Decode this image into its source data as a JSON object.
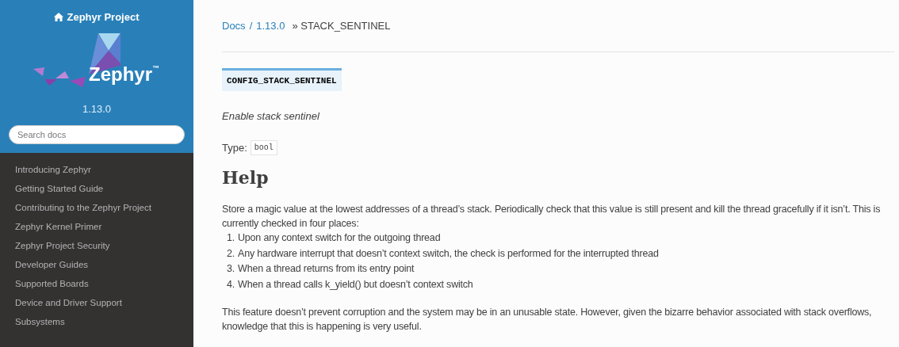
{
  "sidebar": {
    "project_link": "Zephyr Project",
    "logo": {
      "word": "Zephyr",
      "mark": "™"
    },
    "version": "1.13.0",
    "search": {
      "placeholder": "Search docs"
    },
    "items": [
      "Introducing Zephyr",
      "Getting Started Guide",
      "Contributing to the Zephyr Project",
      "Zephyr Kernel Primer",
      "Zephyr Project Security",
      "Developer Guides",
      "Supported Boards",
      "Device and Driver Support",
      "Subsystems"
    ]
  },
  "breadcrumb": {
    "links": [
      "Docs",
      "1.13.0"
    ],
    "separator": "/",
    "current": "» STACK_SENTINEL"
  },
  "option": {
    "name": "CONFIG_STACK_SENTINEL",
    "prompt": "Enable stack sentinel",
    "type_label": "Type:",
    "type": "bool"
  },
  "help": {
    "heading": "Help",
    "intro": "Store a magic value at the lowest addresses of a thread’s stack. Periodically check that this value is still present and kill the thread gracefully if it isn’t. This is currently checked in four places:",
    "list": [
      {
        "number": "1.",
        "text": "Upon any context switch for the outgoing thread"
      },
      {
        "number": "2.",
        "text": "Any hardware interrupt that doesn’t context switch, the check is performed for the interrupted thread"
      },
      {
        "number": "3.",
        "text": "When a thread returns from its entry point"
      },
      {
        "number": "4.",
        "text": "When a thread calls k_yield() but doesn’t context switch"
      }
    ],
    "note": "This feature doesn’t prevent corruption and the system may be in an unusable state. However, given the bizarre behavior associated with stack overflows, knowledge that this is happening is very useful."
  }
}
